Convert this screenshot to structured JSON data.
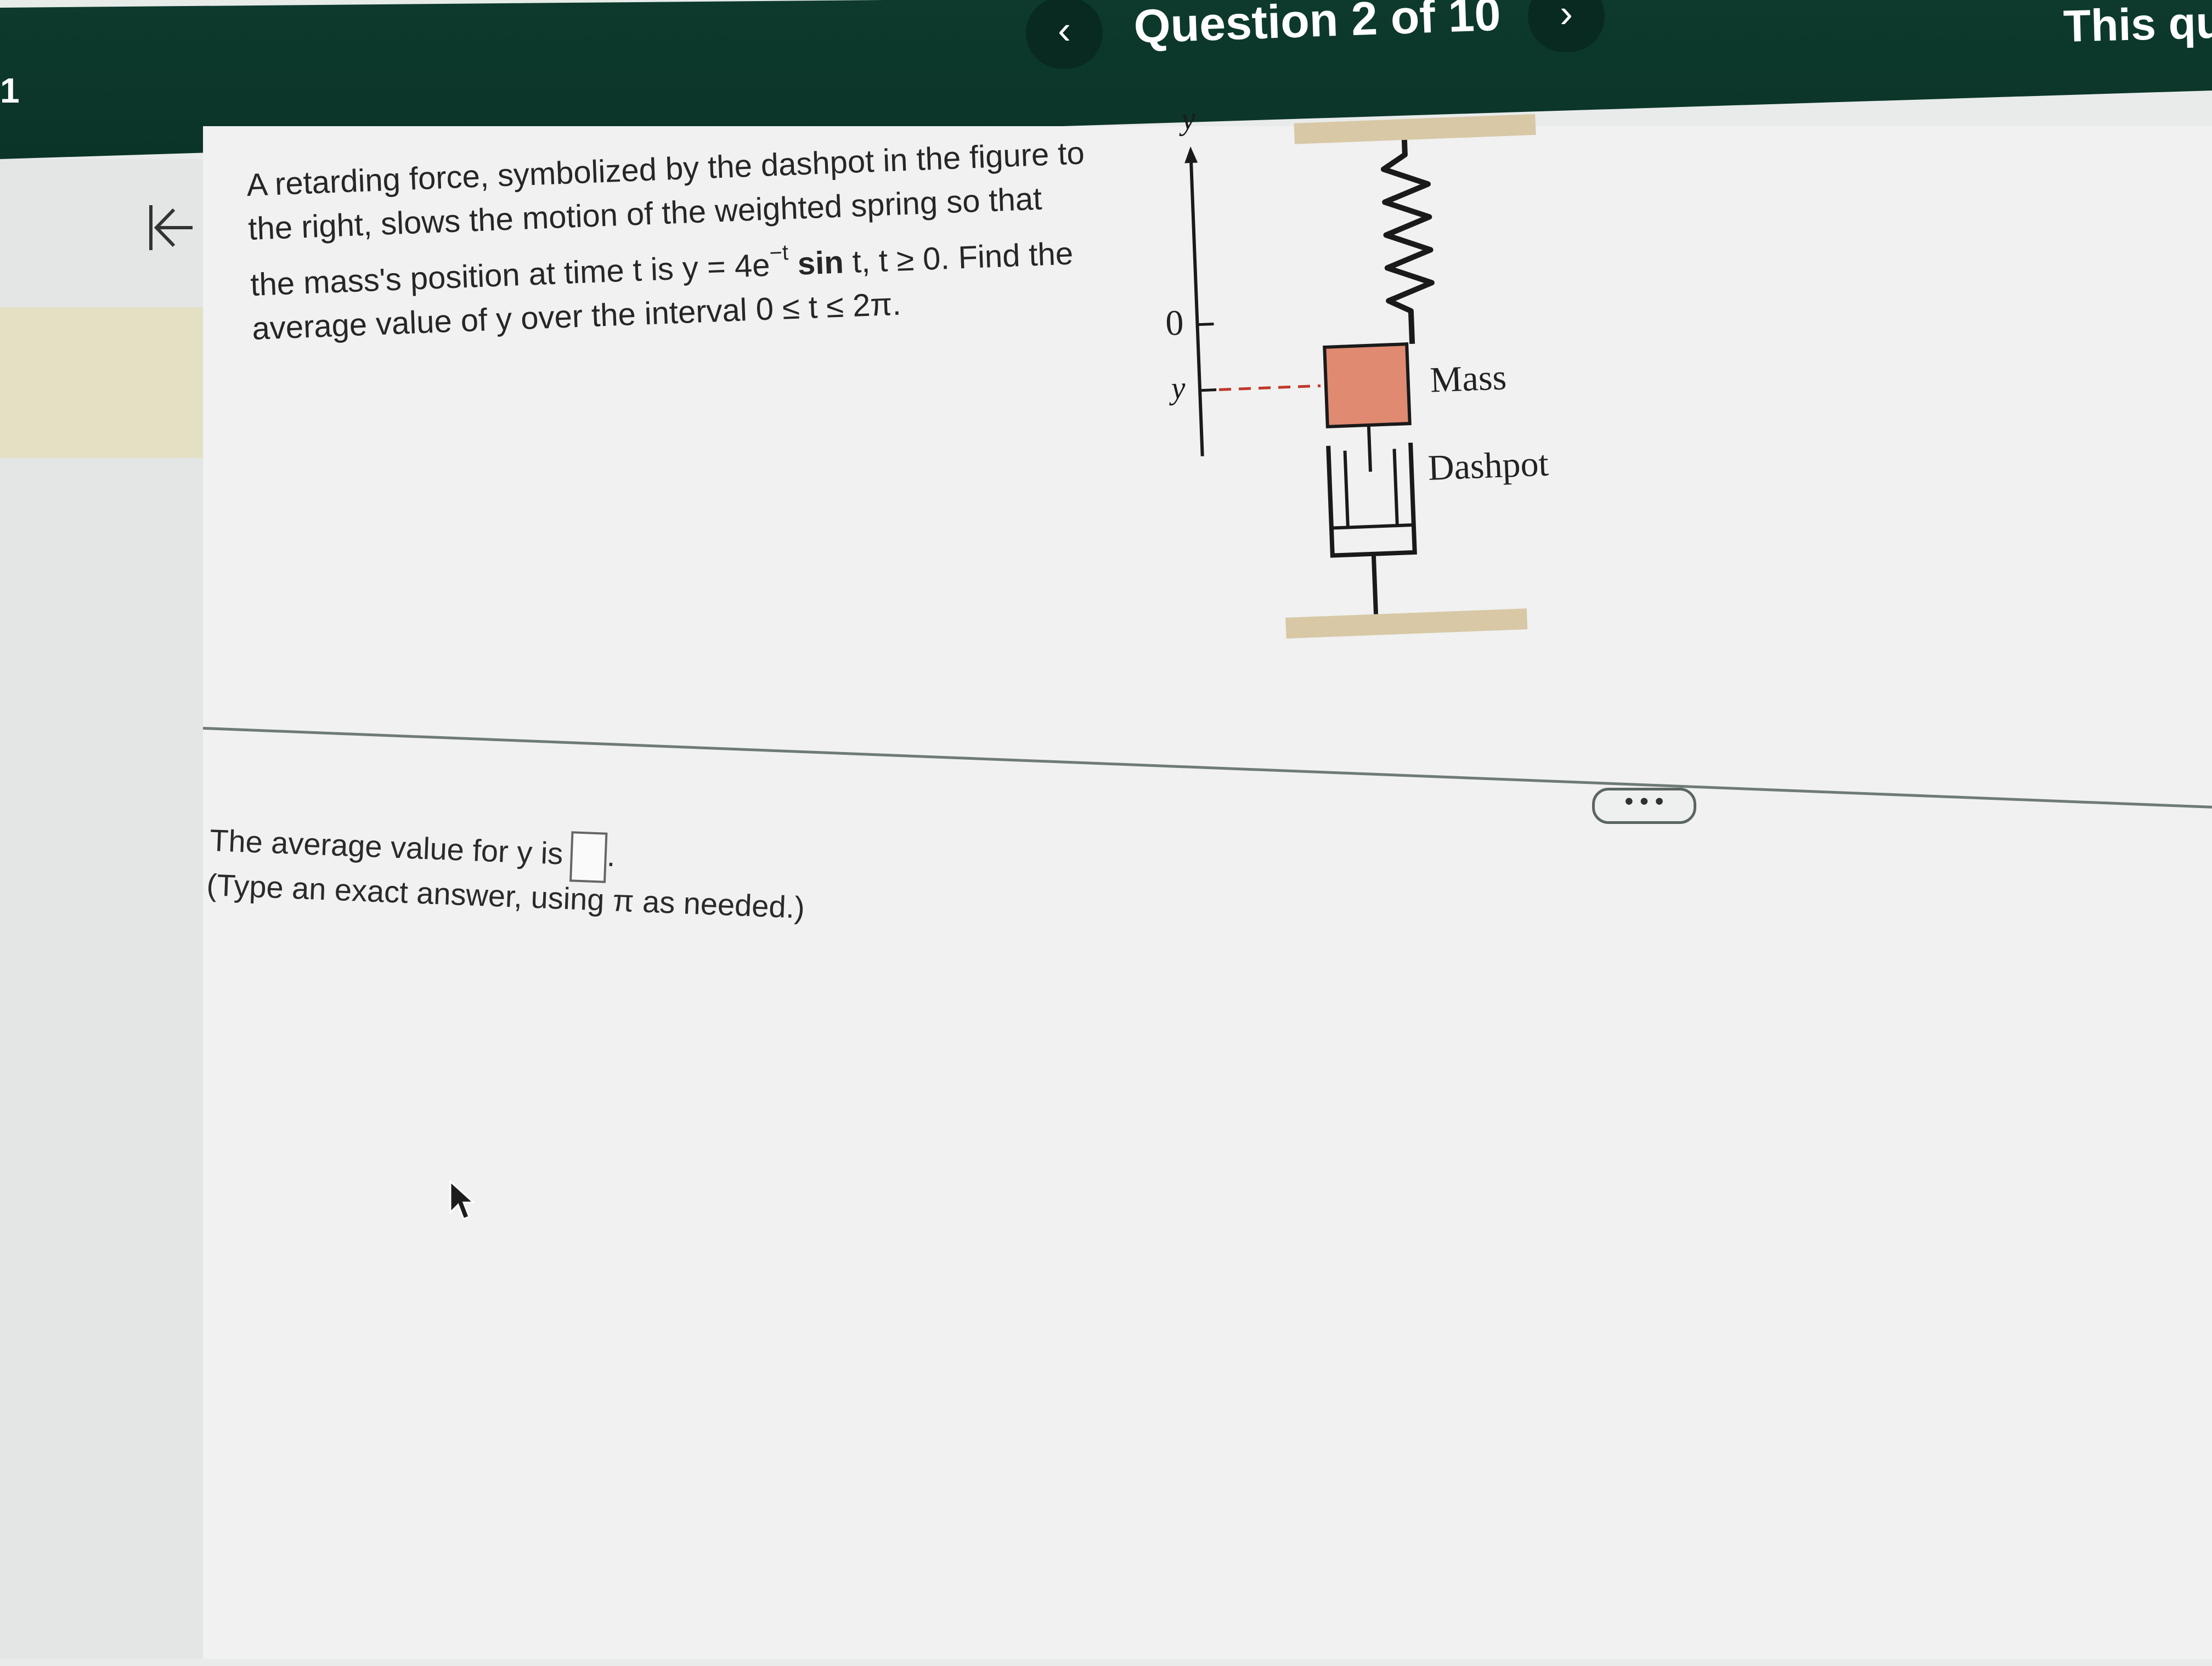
{
  "header": {
    "title": "Question 2 of 10",
    "prev_glyph": "‹",
    "next_glyph": "›",
    "left_number": "1",
    "right_text": "This qu"
  },
  "sidebar": {
    "collapse_icon": "collapse-left-icon"
  },
  "question": {
    "line1": "A retarding force, symbolized by the dashpot in the figure to",
    "line2": "the right, slows the motion of the weighted spring so that",
    "line3_prefix": "the mass's position at time t is y = 4e",
    "line3_sup": "−t",
    "line3_bold": " sin",
    "line3_suffix": " t, t ≥ 0. Find the",
    "line4": "average value of y over the interval 0 ≤ t ≤ 2π."
  },
  "figure": {
    "axis_label_top": "y",
    "axis_zero": "0",
    "axis_y": "y",
    "mass_label": "Mass",
    "dashpot_label": "Dashpot",
    "colors": {
      "mass": "#e08a72",
      "wood": "#d8c8a6",
      "line": "#1a1a1a",
      "dash": "#c0392b"
    }
  },
  "answer": {
    "prompt": "The average value for y is",
    "end": ".",
    "hint": "(Type an exact answer, using π as needed.)"
  },
  "more_button": "• • •"
}
